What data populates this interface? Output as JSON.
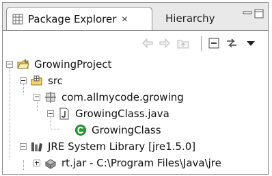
{
  "tabs": [
    {
      "label": "Package Explorer",
      "active": true,
      "close_glyph": "✕",
      "icon": "package-explorer-icon"
    },
    {
      "label": "Hierarchy",
      "active": false,
      "icon": null
    }
  ],
  "window_buttons": [
    "minimize-icon",
    "maximize-icon"
  ],
  "toolbar": {
    "buttons": [
      "back-arrow-icon",
      "forward-arrow-icon",
      "up-folder-icon",
      "collapse-all-icon",
      "link-with-editor-icon",
      "view-menu-icon"
    ]
  },
  "tree": [
    {
      "label": "GrowingProject",
      "icon": "project-folder-icon",
      "expanded": true
    },
    {
      "label": "src",
      "icon": "source-folder-icon",
      "expanded": true
    },
    {
      "label": "com.allmycode.growing",
      "icon": "package-icon",
      "expanded": true
    },
    {
      "label": "GrowingClass.java",
      "icon": "java-file-icon",
      "expanded": true
    },
    {
      "label": "GrowingClass",
      "icon": "class-icon",
      "expanded": null
    },
    {
      "label": "JRE System Library [jre1.5.0]",
      "icon": "library-icon",
      "expanded": true
    },
    {
      "label": "rt.jar - C:\\Program Files\\Java\\jre",
      "icon": "jar-icon",
      "expanded": false
    }
  ],
  "colors": {
    "accent_green": "#2e9a3a",
    "folder_yellow": "#f2d56a",
    "package_gray": "#6f6f6f"
  }
}
